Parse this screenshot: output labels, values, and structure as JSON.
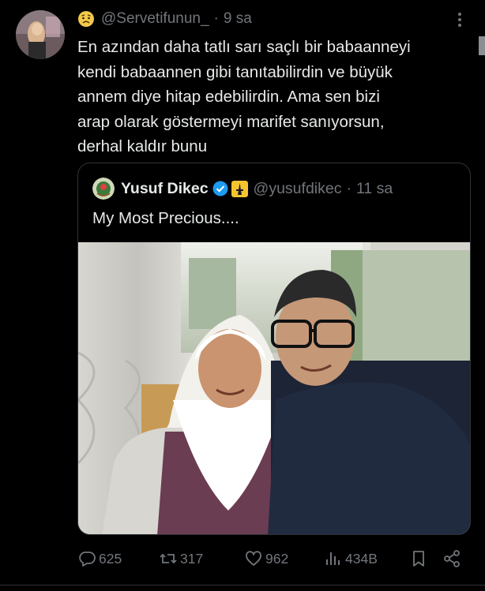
{
  "tweet": {
    "handle": "@Servetifunun_",
    "separator": "·",
    "time": "9 sa",
    "lines": [
      "En azından daha tatlı sarı saçlı bir babaanneyi",
      "kendi babaannen gibi tanıtabilirdin ve büyük",
      "annem diye hitap edebilirdin. Ama sen bizi",
      "arap olarak göstermeyi marifet sanıyorsun,",
      "derhal kaldır bunu"
    ]
  },
  "quote": {
    "name": "Yusuf Dikec",
    "handle": "@yusufdikec",
    "separator": "·",
    "time": "11 sa",
    "text": "My Most Precious....",
    "verified_color": "#1d9bf0",
    "badge_color": "#f4c430"
  },
  "actions": {
    "replies": "625",
    "retweets": "317",
    "likes": "962",
    "views": "434B"
  },
  "icons": {
    "face": "worried-face-emoji",
    "more": "more-dots-icon",
    "reply": "reply-bubble-icon",
    "retweet": "retweet-icon",
    "like": "heart-icon",
    "views": "views-bar-icon",
    "bookmark": "bookmark-icon",
    "share": "share-icon"
  }
}
